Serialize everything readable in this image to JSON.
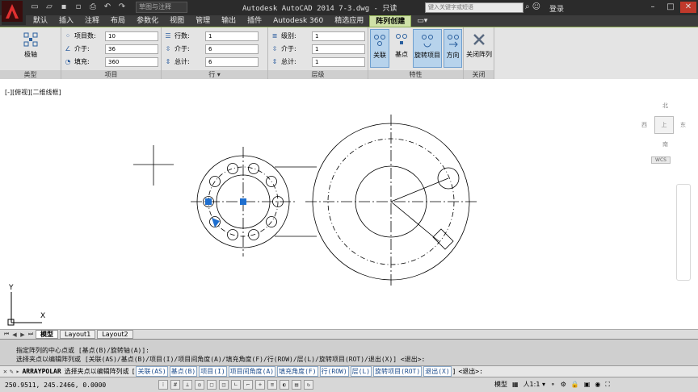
{
  "titlebar": {
    "workspace": "草图与注释",
    "title": "Autodesk AutoCAD 2014    7-3.dwg - 只读",
    "search_placeholder": "键入关键字或短语",
    "login": "登录"
  },
  "ribbon_tabs": [
    {
      "label": "默认"
    },
    {
      "label": "插入"
    },
    {
      "label": "注释"
    },
    {
      "label": "布局"
    },
    {
      "label": "参数化"
    },
    {
      "label": "视图"
    },
    {
      "label": "管理"
    },
    {
      "label": "输出"
    },
    {
      "label": "插件"
    },
    {
      "label": "Autodesk 360"
    },
    {
      "label": "精选应用"
    },
    {
      "label": "阵列创建"
    }
  ],
  "ribbon": {
    "type_panel": {
      "button": "极轴",
      "title": "类型"
    },
    "items_panel": {
      "title": "项目",
      "fields": [
        {
          "label": "项目数:",
          "value": "10"
        },
        {
          "label": "介于:",
          "value": "36"
        },
        {
          "label": "填充:",
          "value": "360"
        }
      ]
    },
    "rows_panel": {
      "title": "行 ▾",
      "fields": [
        {
          "label": "行数:",
          "value": "1"
        },
        {
          "label": "介于:",
          "value": "6"
        },
        {
          "label": "总计:",
          "value": "6"
        }
      ]
    },
    "levels_panel": {
      "title": "层级",
      "fields": [
        {
          "label": "级别:",
          "value": "1"
        },
        {
          "label": "介于:",
          "value": "1"
        },
        {
          "label": "总计:",
          "value": "1"
        }
      ]
    },
    "props_panel": {
      "title": "特性",
      "buttons": [
        {
          "label": "关联",
          "on": true
        },
        {
          "label": "基点",
          "on": false
        },
        {
          "label": "旋转项目",
          "on": true
        },
        {
          "label": "方向",
          "on": true
        }
      ]
    },
    "close_panel": {
      "button": "关闭阵列",
      "title": "关闭"
    }
  },
  "viewport": {
    "label": "[-][俯视][二维线框]"
  },
  "viewcube": {
    "north": "北",
    "west": "西",
    "east": "东",
    "south": "南",
    "center": "上",
    "wcs": "WCS"
  },
  "ucs": {
    "x": "X",
    "y": "Y"
  },
  "layout_tabs": [
    {
      "label": "模型",
      "active": true
    },
    {
      "label": "Layout1",
      "active": false
    },
    {
      "label": "Layout2",
      "active": false
    }
  ],
  "command": {
    "history": [
      "指定阵列的中心点或 [基点(B)/旋转轴(A)]:",
      "选择夹点以编辑阵列或 [关联(AS)/基点(B)/项目(I)/项目间角度(A)/填充角度(F)/行(ROW)/层(L)/旋转项目(ROT)/退出(X)] <退出>:"
    ],
    "prompt_name": "ARRAYPOLAR",
    "prompt_text": "选择夹点以编辑阵列或",
    "options": [
      "关联(AS)",
      "基点(B)",
      "项目(I)",
      "项目间角度(A)",
      "填充角度(F)",
      "行(ROW)",
      "层(L)",
      "旋转项目(ROT)",
      "退出(X)"
    ],
    "suffix": "<退出>:"
  },
  "status": {
    "coords": "250.9511, 245.2466, 0.0000",
    "model": "模型",
    "scale": "人1:1 ▾"
  }
}
